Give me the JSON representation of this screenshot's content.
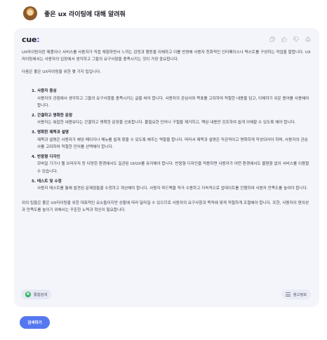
{
  "user": {
    "query": "좋은 ux 라이팅에 대해 알려줘"
  },
  "answer": {
    "logo_text": "cue",
    "logo_suffix": ":",
    "actions": [
      "copy-icon",
      "thumbs-up-icon",
      "thumbs-down-icon",
      "print-icon"
    ],
    "intro": "UX라이팅이란 제품이나 서비스를 사용자가 직접 체험하면서 느끼는 감정과 행동을 이해하고 이를 반영해 사용자 친화적인 인터페이스나 텍스트를 구성하는 작업을 말합니다. UX라이팅에서는 사용자의 입장에서 생각하고 그들의 요구사항을 충족시키는 것이 가장 중요합니다.",
    "lead": "다음은 좋은 UX라이팅을 위한 몇 가지 팁입니다.",
    "tips": [
      {
        "title": "1. 사용자 중심",
        "text": "사용자의 관점에서 생각하고 그들의 요구사항을 충족시키는 글을 써야 합니다. 사용자의 관심사와 목표를 고려하여 적절한 내용을 담고, 이해하기 쉬운 용어를 사용해야 합니다."
      },
      {
        "title": "2. 간결하고 명확한 문장",
        "text": "사용자는 복잡한 내용보다는 간결하고 명확한 문장을 선호합니다. 불필요한 단어나 구절을 제거하고, 핵심 내용만 강조하여 쉽게 이해할 수 있도록 해야 합니다."
      },
      {
        "title": "3. 명확한 제목과 설명",
        "text": "제목과 설명은 사용자가 해당 페이지나 메뉴를 쉽게 찾을 수 있도록 해주는 역할을 합니다. 따라서 제목과 설명은 직관적이고 명확하게 작성되어야 하며, 사용자의 관심사를 고려하여 적절한 단어를 선택해야 합니다."
      },
      {
        "title": "4. 반응형 디자인",
        "text": "모바일 기기나 웹 브라우저 등 다양한 환경에서도 일관된 UI/UX를 유지해야 합니다. 반응형 디자인을 적용하면 사용자가 어떤 환경에서도 불편함 없이 서비스를 이용할 수 있습니다."
      },
      {
        "title": "5. 테스트 및 수정",
        "text": "사용자 테스트를 통해 발견된 문제점들을 수정하고 개선해야 합니다. 사용자 피드백을 적극 수용하고 지속적으로 업데이트를 진행하여 사용자 만족도를 높여야 합니다."
      }
    ],
    "closing": "위의 팁들은 좋은 UX라이팅을 위한 대표적인 요소들이지만 상황에 따라 달라질 수 있으므로 사용자의 요구사항과 목적에 맞게 적절하게 조절해야 합니다. 또한, 사용자의 편의성과 만족도를 높이기 위해서는 꾸준한 노력과 혁신이 필요합니다.",
    "source_chip": "통합검색",
    "source_icon_letter": "N",
    "reference_chip": "참고정보"
  },
  "search_button": "검색하기",
  "colors": {
    "card_bg": "#f4f5fb",
    "brand_blue": "#5577f0",
    "naver_green": "#29b35a"
  }
}
